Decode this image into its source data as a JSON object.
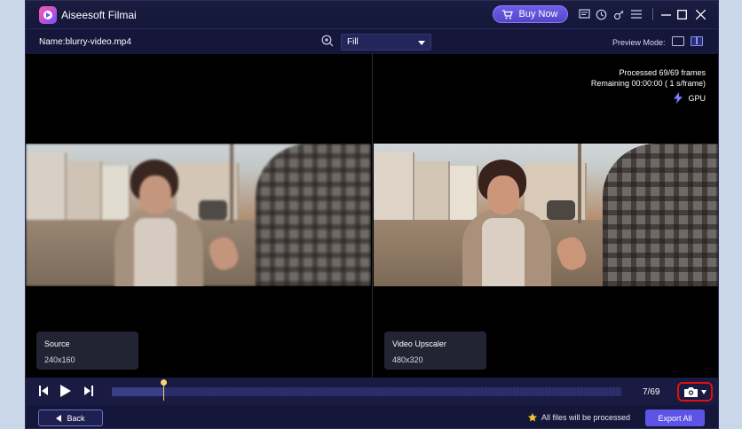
{
  "app": {
    "title": "Aiseesoft Filmai",
    "buy_label": "Buy Now",
    "icons": [
      "feedback-icon",
      "history-icon",
      "key-icon",
      "menu-icon",
      "minimize-icon",
      "maximize-icon",
      "close-icon"
    ]
  },
  "toolbar": {
    "file_name": "Name:blurry-video.mp4",
    "fill_value": "Fill",
    "preview_mode_label": "Preview Mode:"
  },
  "preview": {
    "stats_processed": "Processed 69/69 frames",
    "stats_remaining": "Remaining 00:00:00 ( 1 s/frame)",
    "gpu_label": "GPU",
    "source": {
      "title": "Source",
      "resolution": "240x160"
    },
    "upscaled": {
      "title": "Video Upscaler",
      "resolution": "480x320"
    }
  },
  "playback": {
    "frame_counter": "7/69",
    "current_frame": 7,
    "total_frames": 69
  },
  "footer": {
    "back_label": "Back",
    "note": "All files will be processed",
    "export_label": "Export All"
  },
  "colors": {
    "accent": "#5d54e6",
    "highlight_ring": "#e01010",
    "playhead": "#f5d76e"
  }
}
